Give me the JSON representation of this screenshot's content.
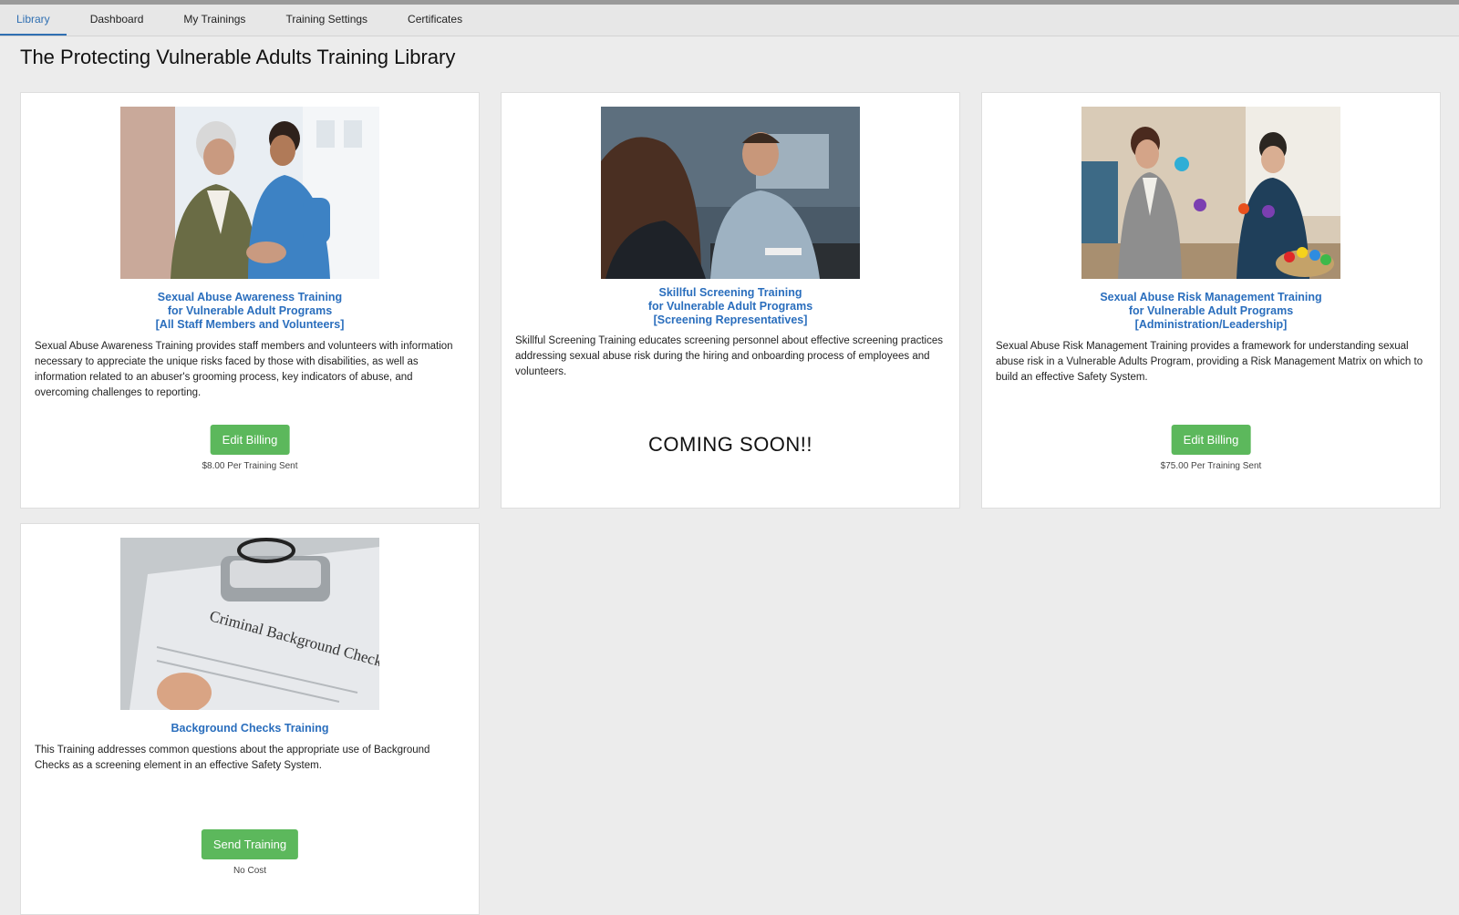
{
  "nav": {
    "tabs": [
      {
        "label": "Library"
      },
      {
        "label": "Dashboard"
      },
      {
        "label": "My Trainings"
      },
      {
        "label": "Training Settings"
      },
      {
        "label": "Certificates"
      }
    ]
  },
  "page": {
    "title": "The Protecting Vulnerable Adults Training Library"
  },
  "cards": [
    {
      "title_lines": [
        "Sexual Abuse Awareness Training",
        "for Vulnerable Adult Programs",
        "[All Staff Members and Volunteers]"
      ],
      "description": "Sexual Abuse Awareness Training provides staff members and volunteers with information necessary to appreciate the unique risks faced by those with disabilities, as well as information related to an abuser's grooming process, key indicators of abuse, and overcoming challenges to reporting.",
      "button_label": "Edit Billing",
      "price": "$8.00 Per Training Sent"
    },
    {
      "title_lines": [
        "Skillful Screening Training",
        "for Vulnerable Adult Programs",
        "[Screening Representatives]"
      ],
      "description": "Skillful Screening Training educates screening personnel about effective screening practices addressing sexual abuse risk during the hiring and onboarding process of employees and volunteers.",
      "status": "COMING SOON!!"
    },
    {
      "title_lines": [
        "Sexual Abuse Risk Management Training",
        "for Vulnerable Adult Programs",
        "[Administration/Leadership]"
      ],
      "description": "Sexual Abuse Risk Management Training provides a framework for understanding sexual abuse risk in a Vulnerable Adults Program, providing a Risk Management Matrix on which to build an effective Safety System.",
      "button_label": "Edit Billing",
      "price": "$75.00 Per Training Sent"
    },
    {
      "title_lines": [
        "Background Checks Training"
      ],
      "description": "This Training addresses common questions about the appropriate use of Background Checks as a screening element in an effective Safety System.",
      "button_label": "Send Training",
      "price": "No Cost",
      "image_text": "Criminal Background Check"
    }
  ],
  "colors": {
    "accent": "#2a6ebd",
    "button": "#5cb85c",
    "background": "#ececec"
  }
}
